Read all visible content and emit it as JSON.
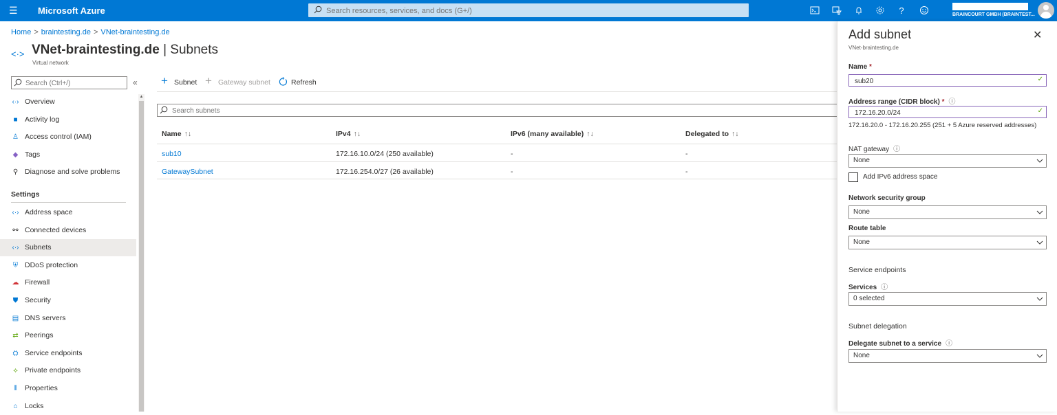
{
  "topbar": {
    "brand": "Microsoft Azure",
    "search_placeholder": "Search resources, services, and docs (G+/)",
    "account_name": "BRAINCOURT GMBH (BRAINTEST...",
    "icons": [
      "cloud-shell-icon",
      "directory-filter-icon",
      "bell-icon",
      "gear-icon",
      "help-icon",
      "feedback-icon"
    ]
  },
  "breadcrumb": {
    "home": "Home",
    "item1": "braintesting.de",
    "item2": "VNet-braintesting.de",
    "sep": ">"
  },
  "page": {
    "title_bold": "VNet-braintesting.de",
    "title_rest": "| Subnets",
    "subtitle": "Virtual network"
  },
  "nav": {
    "search_placeholder": "Search (Ctrl+/)",
    "collapse": "«",
    "items_top": [
      {
        "label": "Overview",
        "icon": "vnet-icon"
      },
      {
        "label": "Activity log",
        "icon": "activity-log-icon"
      },
      {
        "label": "Access control (IAM)",
        "icon": "iam-icon"
      },
      {
        "label": "Tags",
        "icon": "tag-icon"
      },
      {
        "label": "Diagnose and solve problems",
        "icon": "wrench-icon"
      }
    ],
    "section": "Settings",
    "items_settings": [
      {
        "label": "Address space",
        "icon": "vnet-icon"
      },
      {
        "label": "Connected devices",
        "icon": "plug-icon"
      },
      {
        "label": "Subnets",
        "icon": "vnet-icon",
        "selected": true
      },
      {
        "label": "DDoS protection",
        "icon": "shield-icon"
      },
      {
        "label": "Firewall",
        "icon": "firewall-icon"
      },
      {
        "label": "Security",
        "icon": "security-icon"
      },
      {
        "label": "DNS servers",
        "icon": "dns-icon"
      },
      {
        "label": "Peerings",
        "icon": "peering-icon"
      },
      {
        "label": "Service endpoints",
        "icon": "service-endpoint-icon"
      },
      {
        "label": "Private endpoints",
        "icon": "private-endpoint-icon"
      },
      {
        "label": "Properties",
        "icon": "properties-icon"
      },
      {
        "label": "Locks",
        "icon": "lock-icon"
      }
    ]
  },
  "toolbar": {
    "subnet": "Subnet",
    "gateway_subnet": "Gateway subnet",
    "refresh": "Refresh"
  },
  "table": {
    "search_placeholder": "Search subnets",
    "headers": [
      "Name",
      "IPv4",
      "IPv6 (many available)",
      "Delegated to"
    ],
    "sort_glyph": "↑↓",
    "rows": [
      {
        "name": "sub10",
        "ipv4": "172.16.10.0/24 (250 available)",
        "ipv6": "-",
        "delegated": "-"
      },
      {
        "name": "GatewaySubnet",
        "ipv4": "172.16.254.0/27 (26 available)",
        "ipv6": "-",
        "delegated": "-"
      }
    ]
  },
  "panel": {
    "title": "Add subnet",
    "subtitle": "VNet-braintesting.de",
    "close": "✕",
    "name_label": "Name",
    "required": "*",
    "name_value": "sub20",
    "range_label": "Address range (CIDR block)",
    "range_value": "172.16.20.0/24",
    "range_hint": "172.16.20.0 - 172.16.20.255 (251 + 5 Azure reserved addresses)",
    "nat_label": "NAT gateway",
    "nat_value": "None",
    "ipv6_checkbox": "Add IPv6 address space",
    "ipv6_checked": false,
    "nsg_label": "Network security group",
    "nsg_value": "None",
    "route_label": "Route table",
    "route_value": "None",
    "se_section": "Service endpoints",
    "services_label": "Services",
    "services_value": "0 selected",
    "deleg_section": "Subnet delegation",
    "deleg_label": "Delegate subnet to a service",
    "deleg_value": "None",
    "info_glyph": "ⓘ",
    "check_glyph": "✓"
  }
}
